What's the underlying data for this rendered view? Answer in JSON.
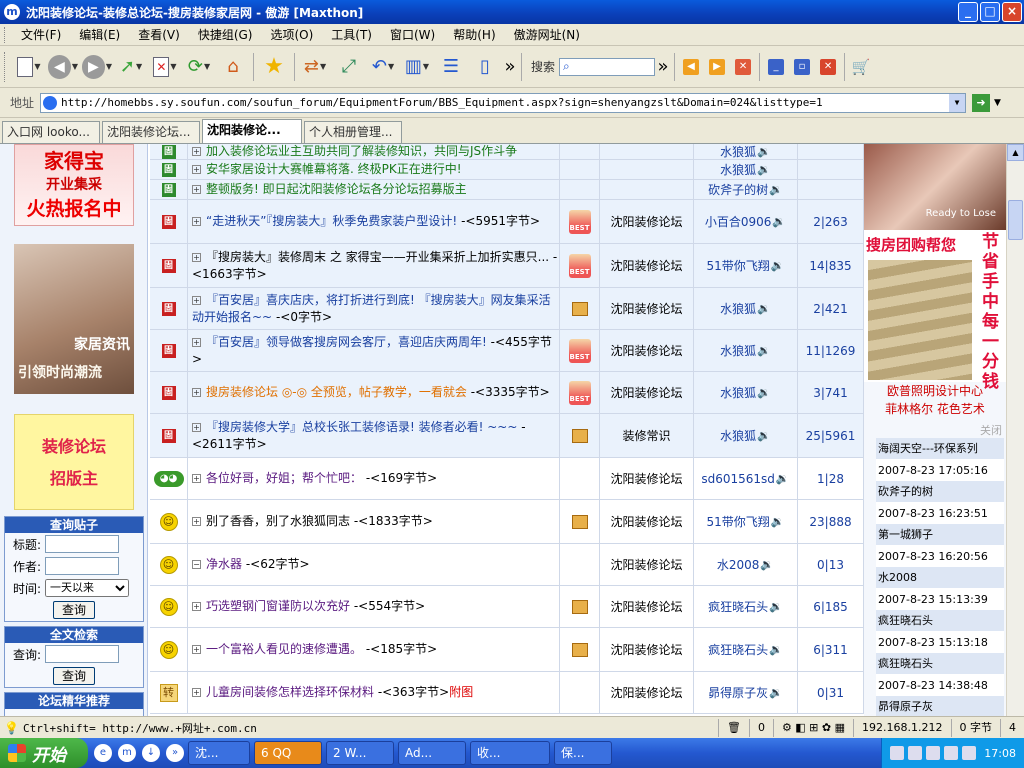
{
  "window": {
    "title": "沈阳装修论坛-装修总论坛-搜房装修家居网 - 傲游 [Maxthon]",
    "buttons": [
      "_",
      "□",
      "×"
    ]
  },
  "menu": [
    "文件(F)",
    "编辑(E)",
    "查看(V)",
    "快捷组(G)",
    "选项(O)",
    "工具(T)",
    "窗口(W)",
    "帮助(H)",
    "傲游网址(N)"
  ],
  "toolbar": {
    "search_label": "搜索",
    "icons": [
      "new-page-icon",
      "back-icon",
      "forward-icon",
      "up-icon",
      "stop-icon",
      "refresh-icon",
      "home-icon",
      "favorites-icon",
      "translate-icon",
      "open-icon",
      "undo-icon",
      "columns-icon",
      "list-icon",
      "page-icon"
    ]
  },
  "address": {
    "label": "地址",
    "url": "http://homebbs.sy.soufun.com/soufun_forum/EquipmentForum/BBS_Equipment.aspx?sign=shenyangzslt&Domain=024&listtype=1"
  },
  "tabs": [
    "入口网 looko...",
    "沈阳装修论坛...",
    "沈阳装修论...",
    "个人相册管理..."
  ],
  "active_tab": 2,
  "left": {
    "ad1": [
      "家得宝",
      "开业集采",
      "火热报名中"
    ],
    "ad2": [
      "家居资讯",
      "引领时尚潮流"
    ],
    "ad3": [
      "装修论坛",
      "招版主"
    ],
    "search_posts": {
      "title": "查询贴子",
      "labels": [
        "标题:",
        "作者:",
        "时间:"
      ],
      "time_value": "一天以来",
      "button": "查询"
    },
    "fulltext": {
      "title": "全文检索",
      "label": "查询:",
      "button": "查询"
    },
    "featured_title": "论坛精华推荐"
  },
  "threads": [
    {
      "icon": "top-grn",
      "title": "加入装修论坛业主互助共同了解装修知识，共同与JS作斗争",
      "title_style": "green",
      "bytes": "",
      "img": "",
      "board": "",
      "author": "水狼狐",
      "counts": "",
      "sticky": true
    },
    {
      "icon": "top-grn",
      "title": "安华家居设计大赛帷幕将落. 终极PK正在进行中!",
      "title_style": "green",
      "bytes": "",
      "img": "",
      "board": "",
      "author": "水狼狐",
      "counts": "",
      "sticky": true
    },
    {
      "icon": "top-grn",
      "title": "整顿版务! 即日起沈阳装修论坛各分论坛招募版主",
      "title_style": "green",
      "bytes": "",
      "img": "",
      "board": "",
      "author": "砍斧子的树",
      "counts": "",
      "sticky": true
    },
    {
      "icon": "top",
      "title": "“走进秋天”『搜房装大』秋季免费家装户型设计!",
      "title_style": "blue",
      "bytes": " -<5951字节>",
      "img": "best",
      "board": "沈阳装修论坛",
      "author": "小百合0906",
      "counts": "2|263",
      "sticky": true
    },
    {
      "icon": "top",
      "title": "『搜房装大』装修周末 之 家得宝——开业集采折上加折实惠只...",
      "title_style": "plain",
      "bytes": " -<1663字节>",
      "img": "best",
      "board": "沈阳装修论坛",
      "author": "51带你飞翔",
      "counts": "14|835",
      "sticky": true
    },
    {
      "icon": "top",
      "title": "『百安居』喜庆店庆，将打折进行到底! 『搜房装大』网友集采活动开始报名~~",
      "title_style": "blue",
      "bytes": " -<0字节>",
      "img": "box",
      "board": "沈阳装修论坛",
      "author": "水狼狐",
      "counts": "2|421",
      "sticky": true
    },
    {
      "icon": "top",
      "title": "『百安居』领导做客搜房网会客厅，喜迎店庆两周年!",
      "title_style": "blue",
      "bytes": " -<455字节>",
      "img": "best",
      "board": "沈阳装修论坛",
      "author": "水狼狐",
      "counts": "11|1269",
      "sticky": true
    },
    {
      "icon": "top",
      "title": "搜房装修论坛 ◎-◎ 全预览，帖子教学，一看就会",
      "title_style": "orange",
      "bytes": " -<3335字节>",
      "img": "best",
      "board": "沈阳装修论坛",
      "author": "水狼狐",
      "counts": "3|741",
      "sticky": true
    },
    {
      "icon": "top",
      "title": "『搜房装修大学』总校长张工装修语录! 装修者必看! ~~~",
      "title_style": "blue",
      "bytes": " -<2611字节>",
      "img": "box",
      "board": "装修常识",
      "author": "水狼狐",
      "counts": "25|5961",
      "sticky": true
    },
    {
      "icon": "frog",
      "title": "各位好哥，好姐；帮个忙吧：",
      "title_style": "purple",
      "bytes": " -<169字节>",
      "img": "",
      "board": "沈阳装修论坛",
      "author": "sd601561sd",
      "counts": "1|28",
      "sticky": false
    },
    {
      "icon": "smile",
      "title": "别了香香，别了水狼狐同志",
      "title_style": "plain",
      "bytes": " -<1833字节>",
      "img": "box",
      "board": "沈阳装修论坛",
      "author": "51带你飞翔",
      "counts": "23|888",
      "sticky": false
    },
    {
      "icon": "smile",
      "title": "净水器",
      "title_style": "purple",
      "bytes": " -<62字节>",
      "img": "",
      "board": "沈阳装修论坛",
      "author": "水2008",
      "counts": "0|13",
      "sticky": false
    },
    {
      "icon": "smile",
      "title": "巧选塑钢门窗谨防以次充好",
      "title_style": "purple",
      "bytes": " -<554字节>",
      "img": "box",
      "board": "沈阳装修论坛",
      "author": "疯狂晓石头",
      "counts": "6|185",
      "sticky": false
    },
    {
      "icon": "smile",
      "title": "一个富裕人看见的速修遭遇。",
      "title_style": "purple",
      "bytes": " -<185字节>",
      "img": "box",
      "board": "沈阳装修论坛",
      "author": "疯狂晓石头",
      "counts": "6|311",
      "sticky": false
    },
    {
      "icon": "zhuan",
      "title": "儿童房间装修怎样选择环保材料",
      "title_style": "purple",
      "bytes": " -<363字节>",
      "attach": "附图",
      "img": "",
      "board": "沈阳装修论坛",
      "author": "昴得原子灰",
      "counts": "0|31",
      "sticky": false
    }
  ],
  "right": {
    "img_label": "Ready to Lose",
    "ad_title": "搜房团购帮您",
    "ad_vertical": "节省手中每一分钱",
    "links": [
      "欧普照明设计中心",
      "菲林格尔 花色艺术"
    ],
    "close": "关闭",
    "latest": [
      {
        "name": "海阔天空---环保系列",
        "time": "2007-8-23 17:05:16"
      },
      {
        "name": "砍斧子的树",
        "time": "2007-8-23 16:23:51"
      },
      {
        "name": "第一城狮子",
        "time": "2007-8-23 16:20:56"
      },
      {
        "name": "水2008",
        "time": "2007-8-23 15:13:39"
      },
      {
        "name": "疯狂晓石头",
        "time": "2007-8-23 15:13:18"
      },
      {
        "name": "疯狂晓石头",
        "time": "2007-8-23 14:38:48"
      },
      {
        "name": "昴得原子灰",
        "time": ""
      }
    ]
  },
  "status": {
    "text": "Ctrl+shift= http://www.+网址+.com.cn",
    "count": "0",
    "ip": "192.168.1.212",
    "bytes": "0 字节",
    "num": "4"
  },
  "taskbar": {
    "start": "开始",
    "tasks": [
      "沈...",
      "6 QQ",
      "2 W...",
      "Ad...",
      "收...",
      "保..."
    ],
    "clock": "17:08"
  }
}
